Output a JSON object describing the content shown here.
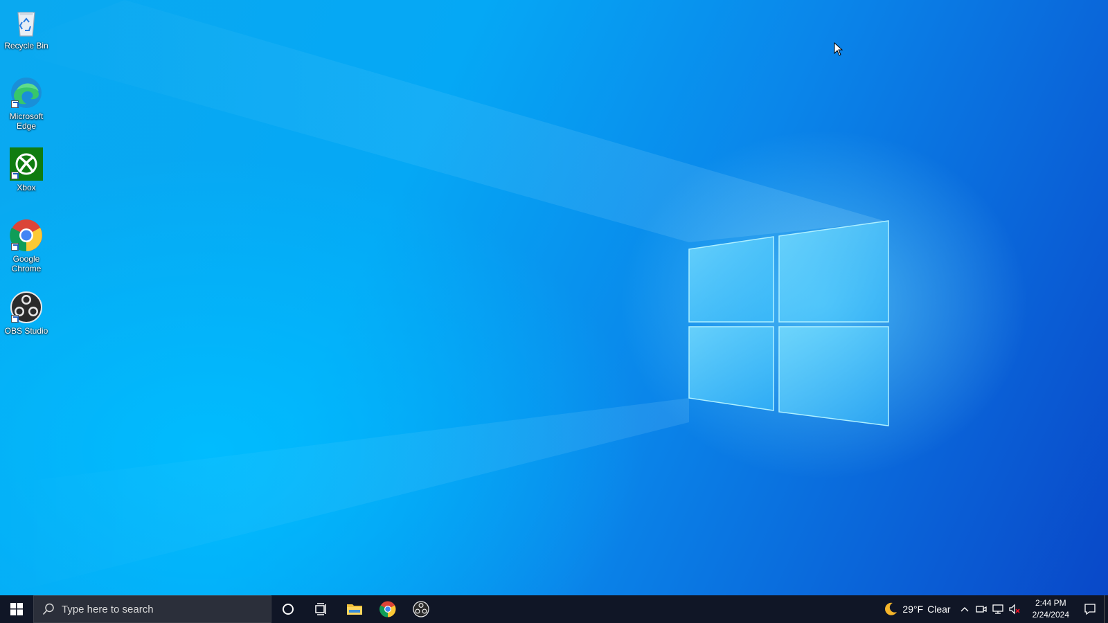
{
  "desktop": {
    "icons": [
      {
        "label": "Recycle Bin",
        "icon": "recycle-bin-icon"
      },
      {
        "label": "Microsoft Edge",
        "icon": "edge-icon"
      },
      {
        "label": "Xbox",
        "icon": "xbox-icon"
      },
      {
        "label": "Google Chrome",
        "icon": "chrome-icon"
      },
      {
        "label": "OBS Studio",
        "icon": "obs-icon"
      }
    ]
  },
  "taskbar": {
    "search_placeholder": "Type here to search",
    "pinned": [
      {
        "icon": "cortana-icon"
      },
      {
        "icon": "task-view-icon"
      },
      {
        "icon": "file-explorer-icon"
      },
      {
        "icon": "chrome-icon"
      },
      {
        "icon": "obs-icon"
      }
    ],
    "weather": {
      "temp": "29°F",
      "condition": "Clear",
      "icon": "moon-icon"
    },
    "clock": {
      "time": "2:44 PM",
      "date": "2/24/2024"
    }
  },
  "colors": {
    "taskbar_bg": "#101626",
    "search_bg": "#2b2f3a",
    "desktop_accent": "#0aa9f0"
  }
}
